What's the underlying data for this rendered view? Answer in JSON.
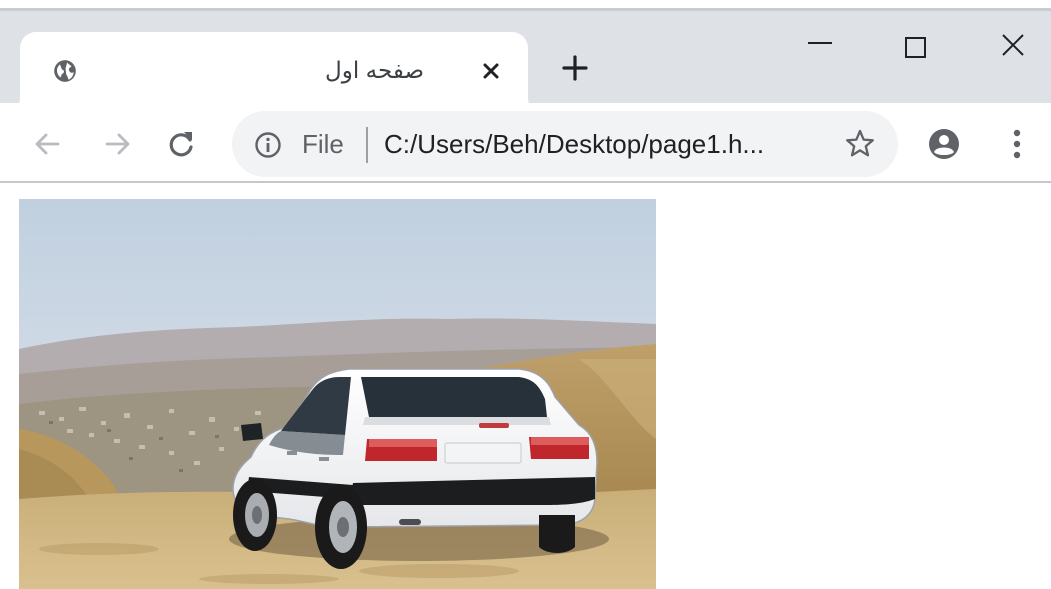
{
  "browser": {
    "tab": {
      "title": "صفحه اول",
      "favicon": "globe-icon"
    },
    "new_tab_icon": "plus-icon",
    "window_controls": [
      "minimize-icon",
      "maximize-icon",
      "close-icon"
    ],
    "toolbar": {
      "back_icon": "arrow-left-icon",
      "forward_icon": "arrow-right-icon",
      "reload_icon": "reload-icon",
      "omnibox": {
        "info_icon": "info-icon",
        "scheme_label": "File",
        "url": "C:/Users/Beh/Desktop/page1.h..."
      },
      "bookmark_icon": "star-icon",
      "profile_icon": "account-icon",
      "menu_icon": "kebab-menu-icon"
    }
  },
  "page": {
    "image": {
      "subject": "white hatchback car on a dirt hill with a town in the valley"
    }
  },
  "colors": {
    "tabstrip": "#dee1e6",
    "omnibox": "#f1f3f4",
    "icon": "#5f6368",
    "text": "#202124"
  }
}
